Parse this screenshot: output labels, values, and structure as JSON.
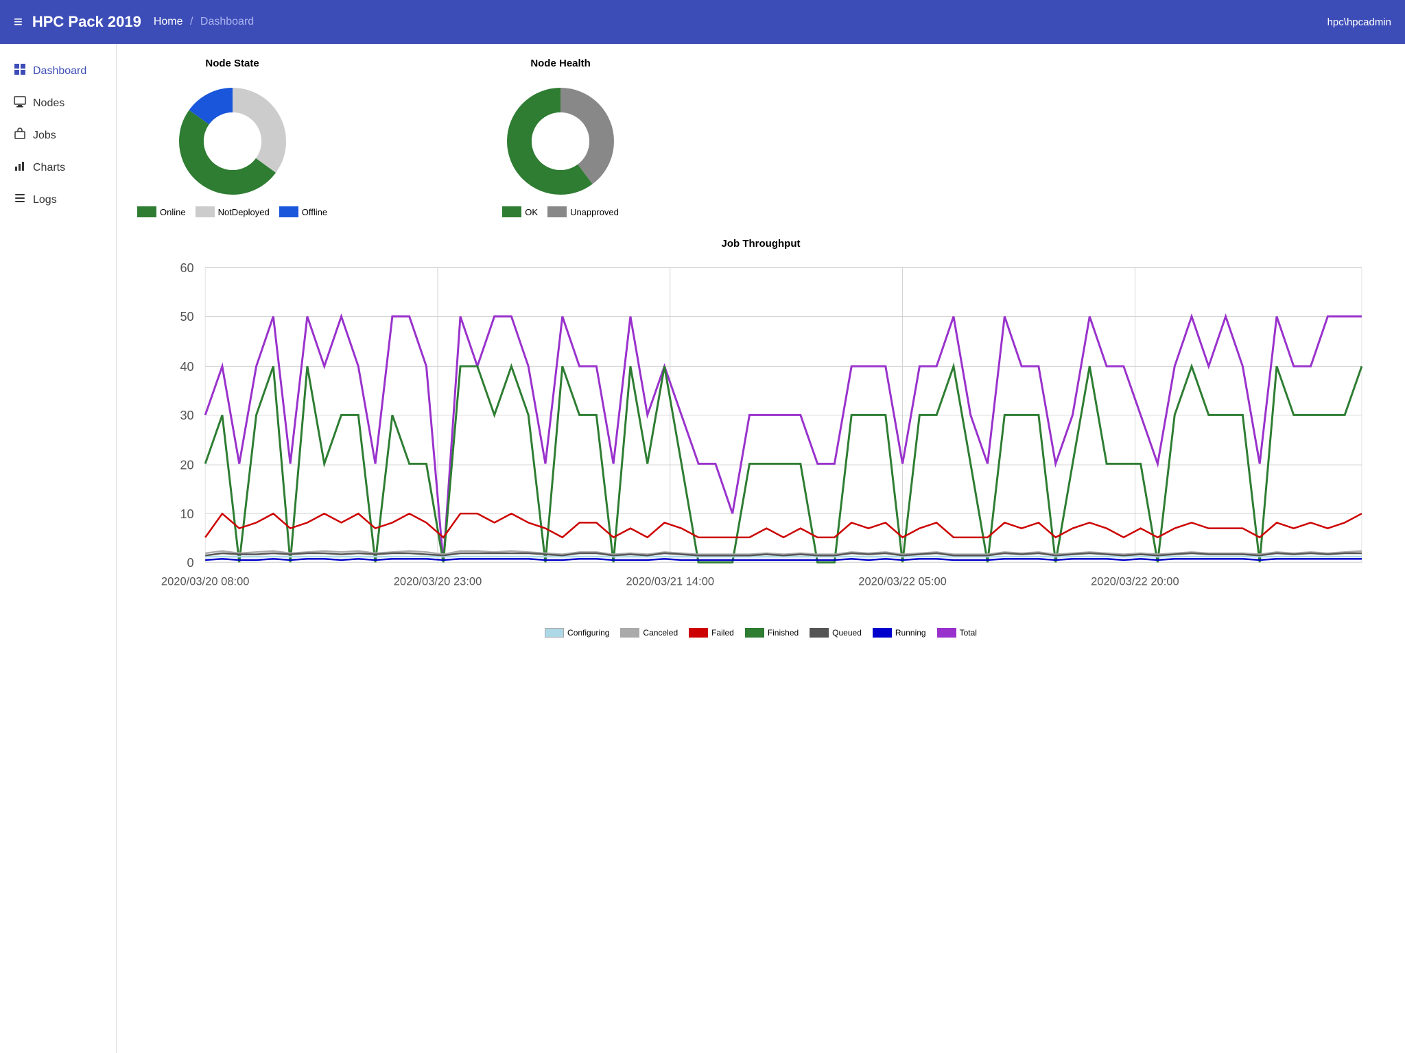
{
  "header": {
    "hamburger": "≡",
    "title": "HPC Pack 2019",
    "breadcrumb_home": "Home",
    "breadcrumb_sep": "/",
    "breadcrumb_current": "Dashboard",
    "user": "hpc\\hpcadmin"
  },
  "sidebar": {
    "items": [
      {
        "id": "dashboard",
        "label": "Dashboard",
        "icon": "grid",
        "active": true
      },
      {
        "id": "nodes",
        "label": "Nodes",
        "icon": "monitor"
      },
      {
        "id": "jobs",
        "label": "Jobs",
        "icon": "briefcase"
      },
      {
        "id": "charts",
        "label": "Charts",
        "icon": "bar-chart"
      },
      {
        "id": "logs",
        "label": "Logs",
        "icon": "list"
      }
    ]
  },
  "nodeState": {
    "title": "Node State",
    "legend": [
      {
        "label": "Online",
        "color": "#2e7d32"
      },
      {
        "label": "NotDeployed",
        "color": "#cccccc"
      },
      {
        "label": "Offline",
        "color": "#1a56db"
      }
    ]
  },
  "nodeHealth": {
    "title": "Node Health",
    "legend": [
      {
        "label": "OK",
        "color": "#2e7d32"
      },
      {
        "label": "Unapproved",
        "color": "#888888"
      }
    ]
  },
  "throughput": {
    "title": "Job Throughput",
    "yMax": 60,
    "yTicks": [
      0,
      10,
      20,
      30,
      40,
      50,
      60
    ],
    "xLabels": [
      "2020/03/20 08:00",
      "2020/03/20 23:00",
      "2020/03/21 14:00",
      "2020/03/22 05:00",
      "2020/03/22 20:00"
    ],
    "legend": [
      {
        "label": "Configuring",
        "color": "#add8e6"
      },
      {
        "label": "Canceled",
        "color": "#aaaaaa"
      },
      {
        "label": "Failed",
        "color": "#cc0000"
      },
      {
        "label": "Finished",
        "color": "#2e7d32"
      },
      {
        "label": "Queued",
        "color": "#555555"
      },
      {
        "label": "Running",
        "color": "#0000cc"
      },
      {
        "label": "Total",
        "color": "#9932cc"
      }
    ]
  }
}
